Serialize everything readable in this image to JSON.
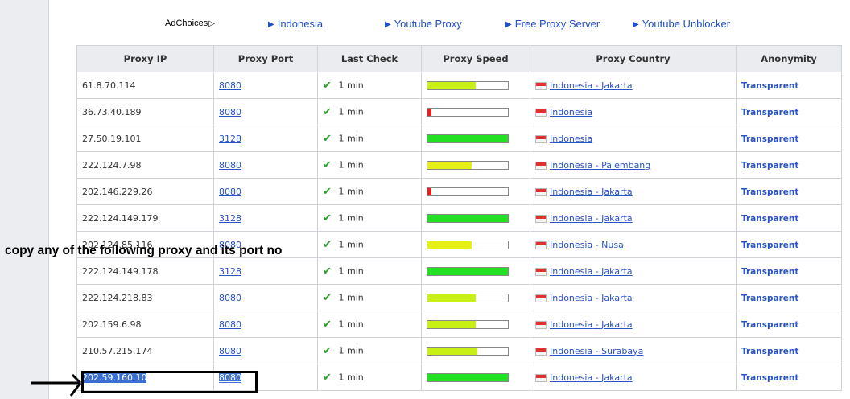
{
  "adbar": {
    "adchoices": "AdChoices",
    "links": [
      "Indonesia",
      "Youtube Proxy",
      "Free Proxy Server",
      "Youtube Unblocker"
    ]
  },
  "columns": [
    "Proxy IP",
    "Proxy Port",
    "Last Check",
    "Proxy Speed",
    "Proxy Country",
    "Anonymity"
  ],
  "rows": [
    {
      "ip": "61.8.70.114",
      "port": "8080",
      "last_check": "1 min",
      "speed": 0.6,
      "speed_color": "#c9f014",
      "country": "Indonesia",
      "city": " - Jakarta",
      "anonymity": "Transparent"
    },
    {
      "ip": "36.73.40.189",
      "port": "8080",
      "last_check": "1 min",
      "speed": 0.05,
      "speed_color": "#e52020",
      "country": "Indonesia",
      "city": "",
      "anonymity": "Transparent"
    },
    {
      "ip": "27.50.19.101",
      "port": "3128",
      "last_check": "1 min",
      "speed": 1.0,
      "speed_color": "#22e022",
      "country": "Indonesia",
      "city": "",
      "anonymity": "Transparent"
    },
    {
      "ip": "222.124.7.98",
      "port": "8080",
      "last_check": "1 min",
      "speed": 0.55,
      "speed_color": "#e6f014",
      "country": "Indonesia",
      "city": " - Palembang",
      "anonymity": "Transparent"
    },
    {
      "ip": "202.146.229.26",
      "port": "8080",
      "last_check": "1 min",
      "speed": 0.05,
      "speed_color": "#e52020",
      "country": "Indonesia",
      "city": " - Jakarta",
      "anonymity": "Transparent"
    },
    {
      "ip": "222.124.149.179",
      "port": "3128",
      "last_check": "1 min",
      "speed": 1.0,
      "speed_color": "#22e022",
      "country": "Indonesia",
      "city": " - Jakarta",
      "anonymity": "Transparent"
    },
    {
      "ip": "202.124.85.116",
      "port": "8080",
      "last_check": "1 min",
      "speed": 0.55,
      "speed_color": "#e6f014",
      "country": "Indonesia",
      "city": " - Nusa",
      "anonymity": "Transparent"
    },
    {
      "ip": "222.124.149.178",
      "port": "3128",
      "last_check": "1 min",
      "speed": 1.0,
      "speed_color": "#22e022",
      "country": "Indonesia",
      "city": " - Jakarta",
      "anonymity": "Transparent"
    },
    {
      "ip": "222.124.218.83",
      "port": "8080",
      "last_check": "1 min",
      "speed": 0.6,
      "speed_color": "#c9f014",
      "country": "Indonesia",
      "city": " - Jakarta",
      "anonymity": "Transparent"
    },
    {
      "ip": "202.159.6.98",
      "port": "8080",
      "last_check": "1 min",
      "speed": 0.6,
      "speed_color": "#c9f014",
      "country": "Indonesia",
      "city": " - Jakarta",
      "anonymity": "Transparent"
    },
    {
      "ip": "210.57.215.174",
      "port": "8080",
      "last_check": "1 min",
      "speed": 0.62,
      "speed_color": "#c9f014",
      "country": "Indonesia",
      "city": " - Surabaya",
      "anonymity": "Transparent"
    },
    {
      "ip": "202.59.160.10",
      "port": "8080",
      "last_check": "1 min",
      "speed": 1.0,
      "speed_color": "#22e022",
      "country": "Indonesia",
      "city": " - Jakarta",
      "anonymity": "Transparent",
      "selected": true
    }
  ],
  "annotation": {
    "text": "copy any of the following proxy and its   port no"
  },
  "colors": {
    "link": "#2a52c8",
    "header_bg": "#eaecef",
    "selection": "#3b6fd3"
  }
}
